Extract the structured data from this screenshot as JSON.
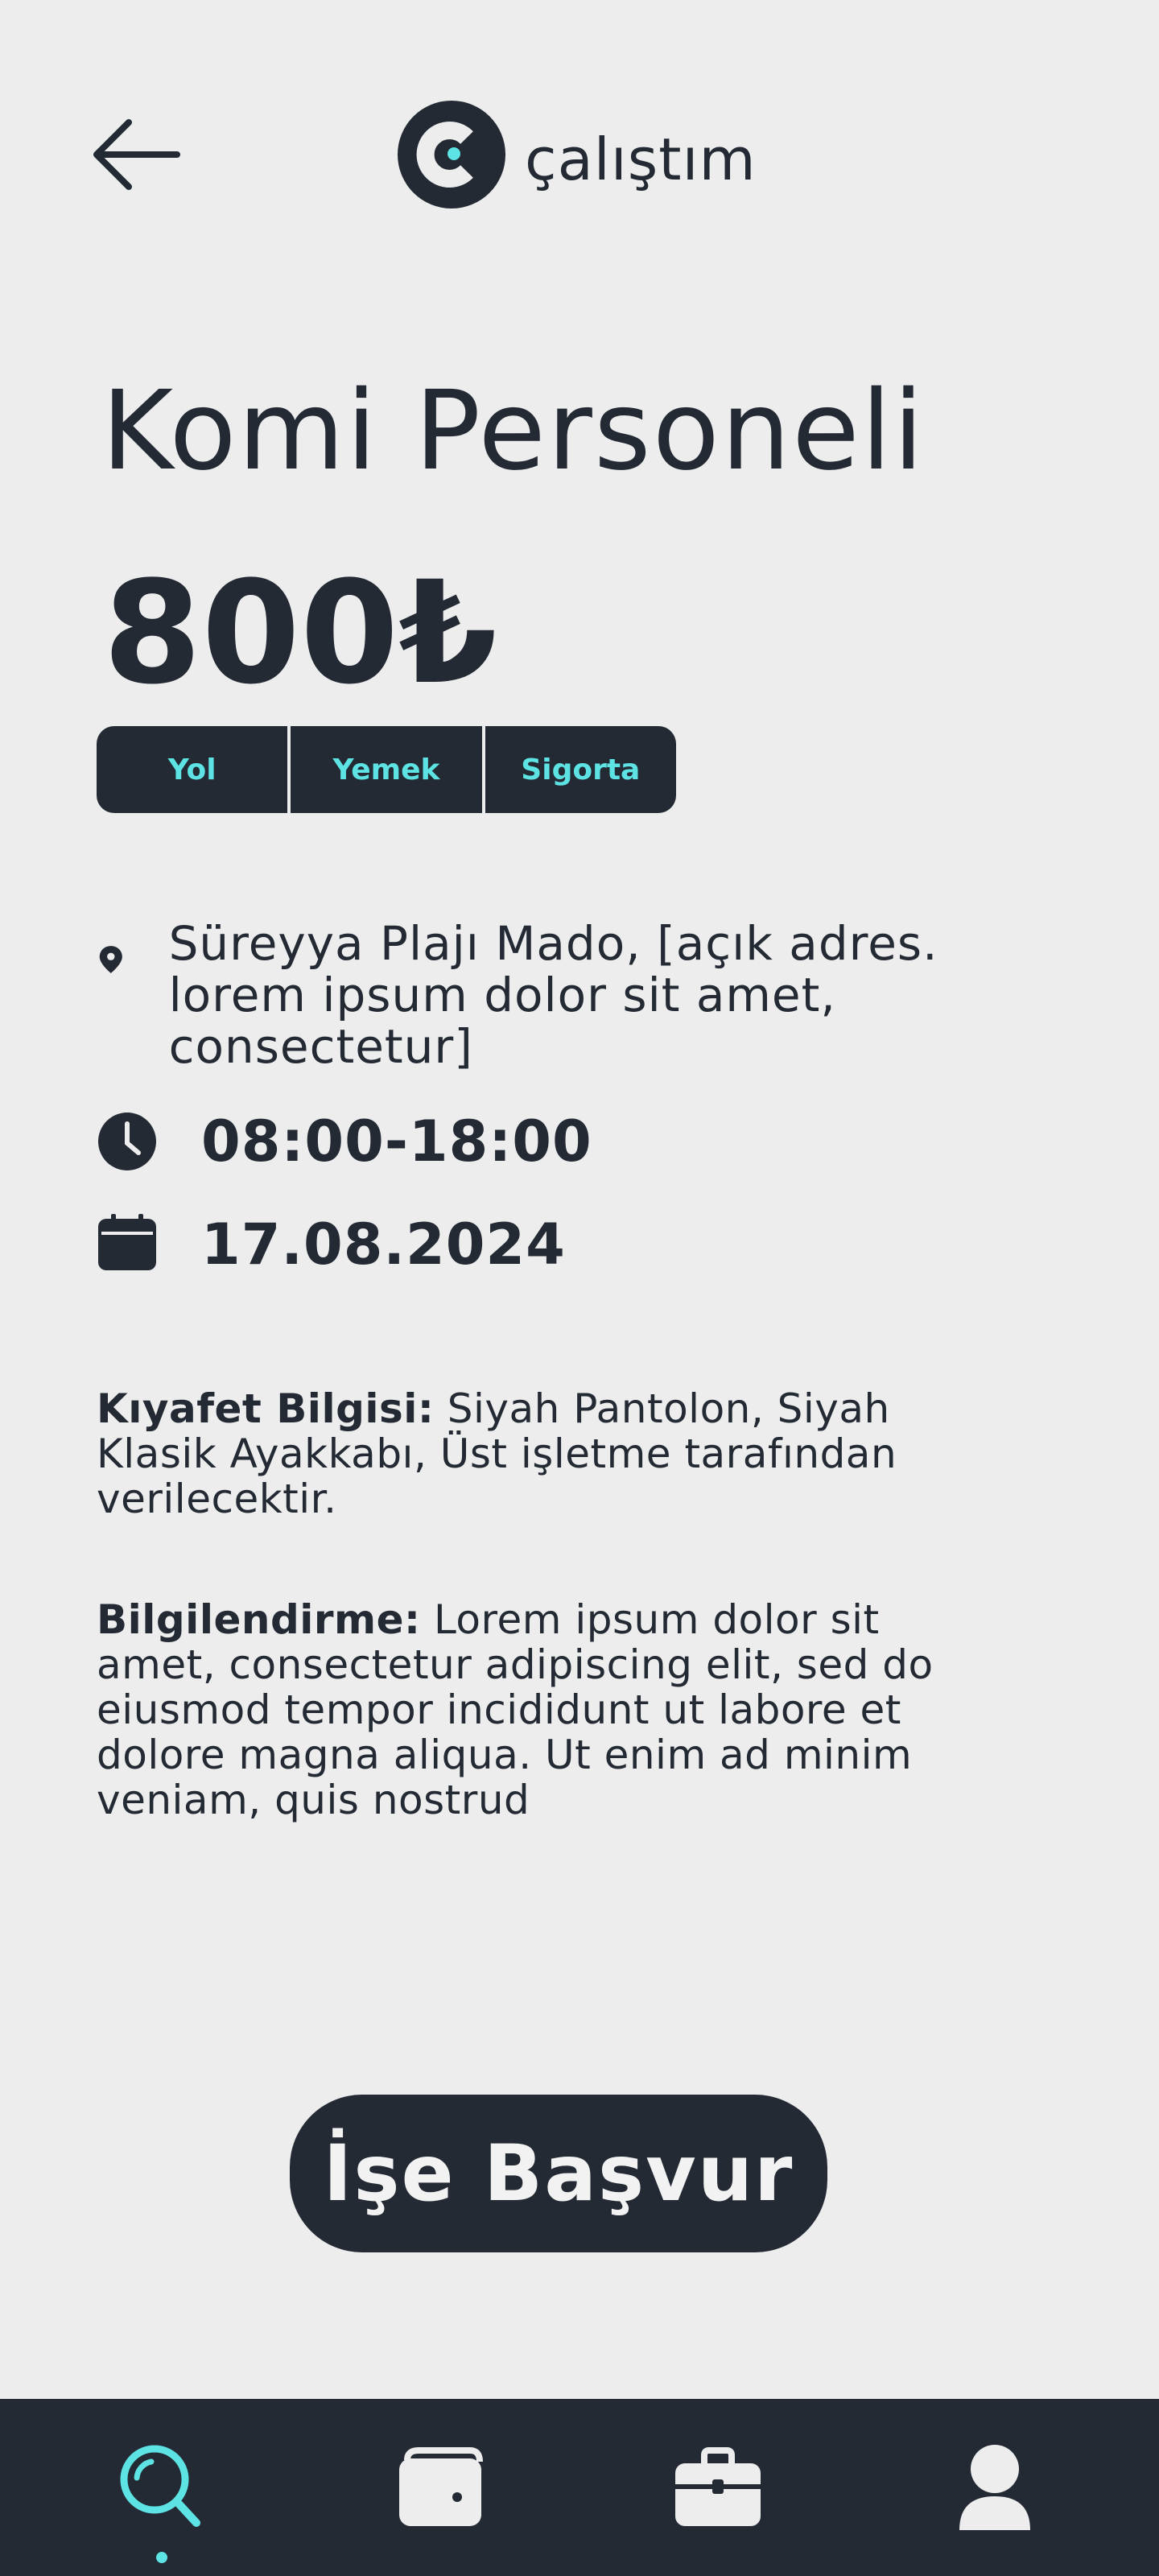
{
  "header": {
    "brand_name": "çalıştım"
  },
  "job": {
    "title": "Komi Personeli",
    "price": "800₺",
    "benefits": [
      "Yol",
      "Yemek",
      "Sigorta"
    ],
    "address": "Süreyya Plajı Mado, [açık adres. lorem ipsum dolor sit amet, consectetur]",
    "hours": "08:00-18:00",
    "date": "17.08.2024",
    "dress_label": "Kıyafet Bilgisi:",
    "dress_text": " Siyah Pantolon, Siyah Klasik Ayakkabı, Üst işletme tarafından verilecektir.",
    "info_label": "Bilgilendirme:",
    "info_text": " Lorem ipsum dolor sit amet, consectetur adipiscing elit, sed do eiusmod tempor incididunt ut labore et dolore magna aliqua. Ut enim ad minim veniam, quis nostrud"
  },
  "actions": {
    "apply_label": "İşe Başvur"
  },
  "nav": {
    "active": "search",
    "items": [
      "search-icon",
      "wallet-icon",
      "briefcase-icon",
      "profile-icon"
    ]
  },
  "colors": {
    "background": "#ededed",
    "dark": "#232a34",
    "accent": "#5de3e3"
  }
}
